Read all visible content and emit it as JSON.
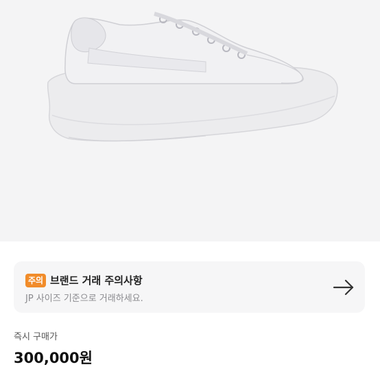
{
  "product": {
    "image_alt_icon": "sneaker-product-image"
  },
  "notice": {
    "badge": "주의",
    "title": "브랜드 거래 주의사항",
    "description": "JP 사이즈 기준으로 거래하세요.",
    "arrow_icon": "arrow-right-icon",
    "badge_color": "#f18c2a"
  },
  "pricing": {
    "label": "즉시 구매가",
    "price": "300,000원"
  }
}
